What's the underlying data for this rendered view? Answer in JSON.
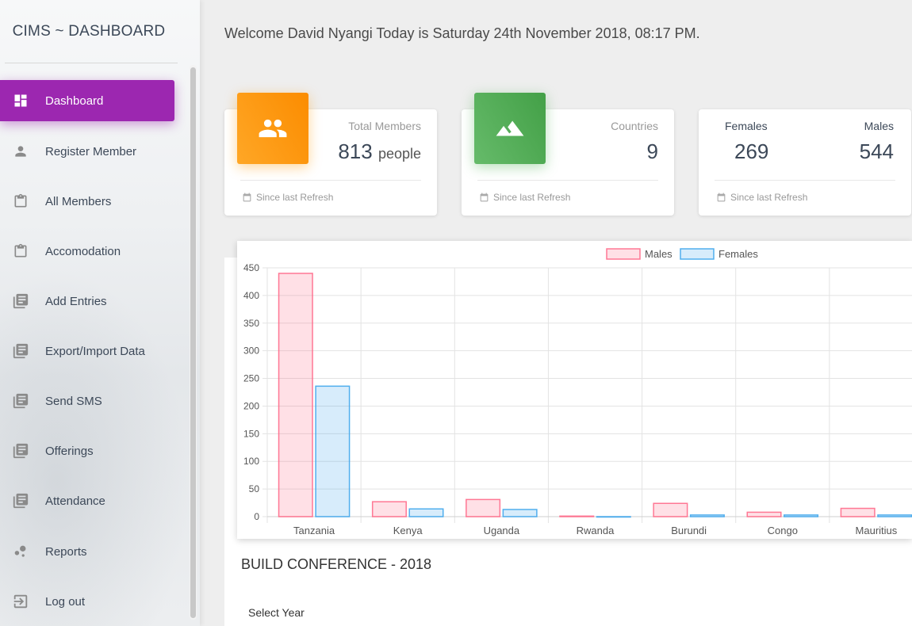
{
  "brand": "CIMS ~ DASHBOARD",
  "welcome": "Welcome David Nyangi Today is Saturday 24th November 2018, 08:17 PM.",
  "nav": [
    {
      "label": "Dashboard",
      "icon": "dashboard-icon"
    },
    {
      "label": "Register Member",
      "icon": "person-icon"
    },
    {
      "label": "All Members",
      "icon": "clipboard-icon"
    },
    {
      "label": "Accomodation",
      "icon": "clipboard-icon"
    },
    {
      "label": "Add Entries",
      "icon": "library-books-icon"
    },
    {
      "label": "Export/Import Data",
      "icon": "library-books-icon"
    },
    {
      "label": "Send SMS",
      "icon": "library-books-icon"
    },
    {
      "label": "Offerings",
      "icon": "library-books-icon"
    },
    {
      "label": "Attendance",
      "icon": "library-books-icon"
    },
    {
      "label": "Reports",
      "icon": "bubble-chart-icon"
    },
    {
      "label": "Log out",
      "icon": "logout-icon"
    }
  ],
  "cards": {
    "members": {
      "category": "Total Members",
      "value": "813",
      "unit": "people",
      "footer": "Since last Refresh",
      "icon": "group-icon",
      "color": "#fb8c00"
    },
    "countries": {
      "category": "Countries",
      "value": "9",
      "footer": "Since last Refresh",
      "icon": "landscape-icon",
      "color": "#43a047"
    },
    "gender": {
      "females_label": "Females",
      "females_value": "269",
      "males_label": "Males",
      "males_value": "544",
      "footer": "Since last Refresh"
    }
  },
  "chart_data": {
    "type": "bar",
    "categories": [
      "Tanzania",
      "Kenya",
      "Uganda",
      "Rwanda",
      "Burundi",
      "Congo",
      "Mauritius"
    ],
    "series": [
      {
        "name": "Males",
        "values": [
          440,
          27,
          31,
          1,
          24,
          8,
          15
        ],
        "color": "#ff6384"
      },
      {
        "name": "Females",
        "values": [
          236,
          14,
          13,
          0,
          3,
          3,
          3
        ],
        "color": "#36a2eb"
      }
    ],
    "yticks": [
      "0",
      "50",
      "100",
      "150",
      "200",
      "250",
      "300",
      "350",
      "400",
      "450"
    ],
    "ylim": [
      0,
      450
    ],
    "grid": true,
    "legend": "top"
  },
  "chart_title": "BUILD CONFERENCE - 2018",
  "select_year_label": "Select Year"
}
